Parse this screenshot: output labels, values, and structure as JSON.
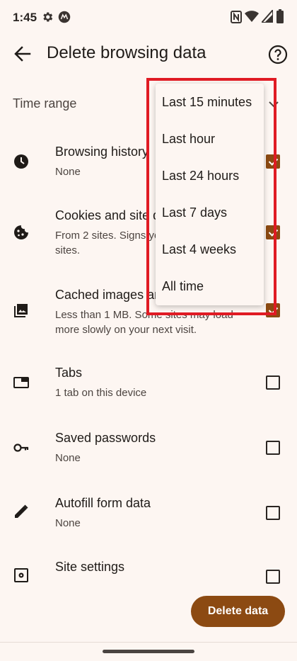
{
  "status_bar": {
    "time": "1:45",
    "icons": [
      "settings-icon",
      "motorola-icon",
      "nfc-icon",
      "wifi-icon",
      "signal-icon",
      "battery-icon"
    ]
  },
  "app_bar": {
    "title": "Delete browsing data",
    "back_icon": "arrow-back-icon",
    "help_icon": "help-icon"
  },
  "time_range": {
    "label": "Time range",
    "selected": "Last 15 minutes"
  },
  "dropdown": {
    "options": [
      "Last 15 minutes",
      "Last hour",
      "Last 24 hours",
      "Last 7 days",
      "Last 4 weeks",
      "All time"
    ]
  },
  "items": [
    {
      "title": "Browsing history",
      "subtitle": [
        "None"
      ],
      "checked": true,
      "icon": "clock-icon"
    },
    {
      "title": "Cookies and site data",
      "subtitle": [
        "From 2 sites. Signs you out of most",
        "sites."
      ],
      "checked": true,
      "icon": "cookie-icon"
    },
    {
      "title": "Cached images and files",
      "subtitle": [
        "Less than 1 MB. Some sites may load",
        "more slowly on your next visit."
      ],
      "checked": true,
      "icon": "image-icon"
    },
    {
      "title": "Tabs",
      "subtitle": [
        "1 tab on this device"
      ],
      "checked": false,
      "icon": "tab-icon"
    },
    {
      "title": "Saved passwords",
      "subtitle": [
        "None"
      ],
      "checked": false,
      "icon": "key-icon"
    },
    {
      "title": "Autofill form data",
      "subtitle": [
        "None"
      ],
      "checked": false,
      "icon": "pencil-icon"
    },
    {
      "title": "Site settings",
      "subtitle": [],
      "checked": false,
      "icon": "site-settings-icon"
    }
  ],
  "delete_button": "Delete data",
  "colors": {
    "background": "#fdf6f2",
    "accent": "#8c4a12",
    "highlight": "#e01b24"
  }
}
